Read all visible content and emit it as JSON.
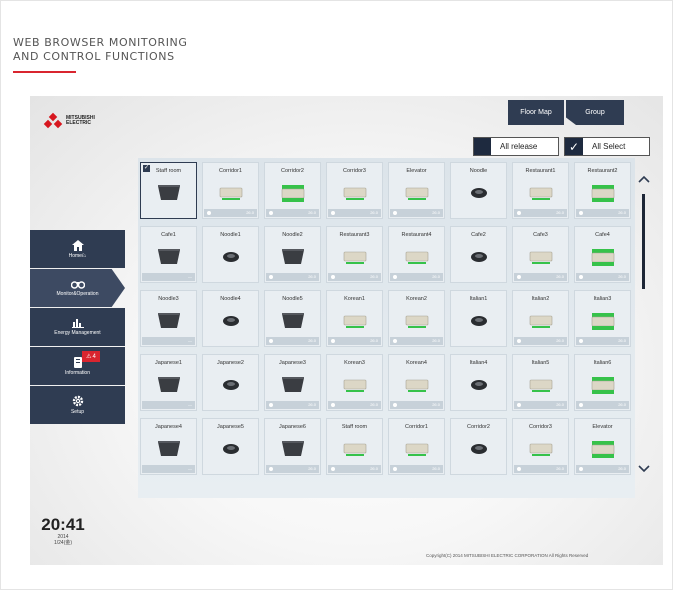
{
  "page": {
    "heading_line1": "WEB BROWSER MONITORING",
    "heading_line2": "AND CONTROL FUNCTIONS"
  },
  "app": {
    "logo": "MITSUBISHI ELECTRIC",
    "top_buttons": {
      "floor_map": "Floor Map",
      "group": "Group"
    },
    "all_release": "All release",
    "all_select": "All Select",
    "sidebar": [
      {
        "label": "Home/⌂",
        "icon": "home-icon"
      },
      {
        "label": "Monitor&Operation",
        "icon": "binoculars-icon"
      },
      {
        "label": "Energy Management",
        "icon": "bar-chart-icon"
      },
      {
        "label": "Information",
        "icon": "alert-icon",
        "badge": "4"
      },
      {
        "label": "Setup",
        "icon": "gear-icon"
      }
    ],
    "grid": [
      [
        {
          "name": "Staff room",
          "type": "cassette",
          "temp": "",
          "selected": true
        },
        {
          "name": "Corridor1",
          "type": "wall",
          "temp": "26.0"
        },
        {
          "name": "Corridor2",
          "type": "wall-on",
          "temp": "26.0"
        },
        {
          "name": "Corridor3",
          "type": "wall",
          "temp": "26.0"
        },
        {
          "name": "Elevator",
          "type": "wall",
          "temp": "26.0"
        },
        {
          "name": "Noodle",
          "type": "round",
          "temp": ""
        },
        {
          "name": "Restaurant1",
          "type": "wall",
          "temp": "26.0"
        },
        {
          "name": "Restaurant2",
          "type": "wall-on",
          "temp": "26.0"
        }
      ],
      [
        {
          "name": "Cafe1",
          "type": "cassette",
          "temp": "—"
        },
        {
          "name": "Noodle1",
          "type": "round",
          "temp": ""
        },
        {
          "name": "Noodle2",
          "type": "cassette",
          "temp": "26.0"
        },
        {
          "name": "Restaurant3",
          "type": "wall",
          "temp": "26.0"
        },
        {
          "name": "Restaurant4",
          "type": "wall",
          "temp": "26.0"
        },
        {
          "name": "Cafe2",
          "type": "round",
          "temp": ""
        },
        {
          "name": "Cafe3",
          "type": "wall",
          "temp": "26.0"
        },
        {
          "name": "Cafe4",
          "type": "wall-on",
          "temp": "26.0"
        }
      ],
      [
        {
          "name": "Noodle3",
          "type": "cassette",
          "temp": "—"
        },
        {
          "name": "Noodle4",
          "type": "round",
          "temp": ""
        },
        {
          "name": "Noodle5",
          "type": "cassette",
          "temp": "26.0"
        },
        {
          "name": "Korean1",
          "type": "wall",
          "temp": "26.0"
        },
        {
          "name": "Korean2",
          "type": "wall",
          "temp": "26.0"
        },
        {
          "name": "Italian1",
          "type": "round",
          "temp": ""
        },
        {
          "name": "Italian2",
          "type": "wall",
          "temp": "26.0"
        },
        {
          "name": "Italian3",
          "type": "wall-on",
          "temp": "26.0"
        }
      ],
      [
        {
          "name": "Japanese1",
          "type": "cassette",
          "temp": "—"
        },
        {
          "name": "Japanese2",
          "type": "round",
          "temp": ""
        },
        {
          "name": "Japanese3",
          "type": "cassette",
          "temp": "26.0"
        },
        {
          "name": "Korean3",
          "type": "wall",
          "temp": "26.0"
        },
        {
          "name": "Korean4",
          "type": "wall",
          "temp": "26.0"
        },
        {
          "name": "Italian4",
          "type": "round",
          "temp": ""
        },
        {
          "name": "Italian5",
          "type": "wall",
          "temp": "26.0"
        },
        {
          "name": "Italian6",
          "type": "wall-on",
          "temp": "26.0"
        }
      ],
      [
        {
          "name": "Japanese4",
          "type": "cassette",
          "temp": "—"
        },
        {
          "name": "Japanese5",
          "type": "round",
          "temp": ""
        },
        {
          "name": "Japanese6",
          "type": "cassette",
          "temp": "26.0"
        },
        {
          "name": "Staff room",
          "type": "wall",
          "temp": "26.0"
        },
        {
          "name": "Corridor1",
          "type": "wall",
          "temp": "26.0"
        },
        {
          "name": "Corridor2",
          "type": "round",
          "temp": ""
        },
        {
          "name": "Corridor3",
          "type": "wall",
          "temp": "26.0"
        },
        {
          "name": "Elevator",
          "type": "wall-on",
          "temp": "26.0"
        }
      ]
    ],
    "clock": {
      "time": "20:41",
      "year": "2014",
      "date": "1/24(金)"
    },
    "copyright": "Copyright(C) 2014 MITSUBISHI ELECTRIC CORPORATION All Rights Reserved"
  },
  "colors": {
    "nav": "#2f3c52",
    "accent_red": "#d9252f",
    "status_green": "#36c24a"
  }
}
